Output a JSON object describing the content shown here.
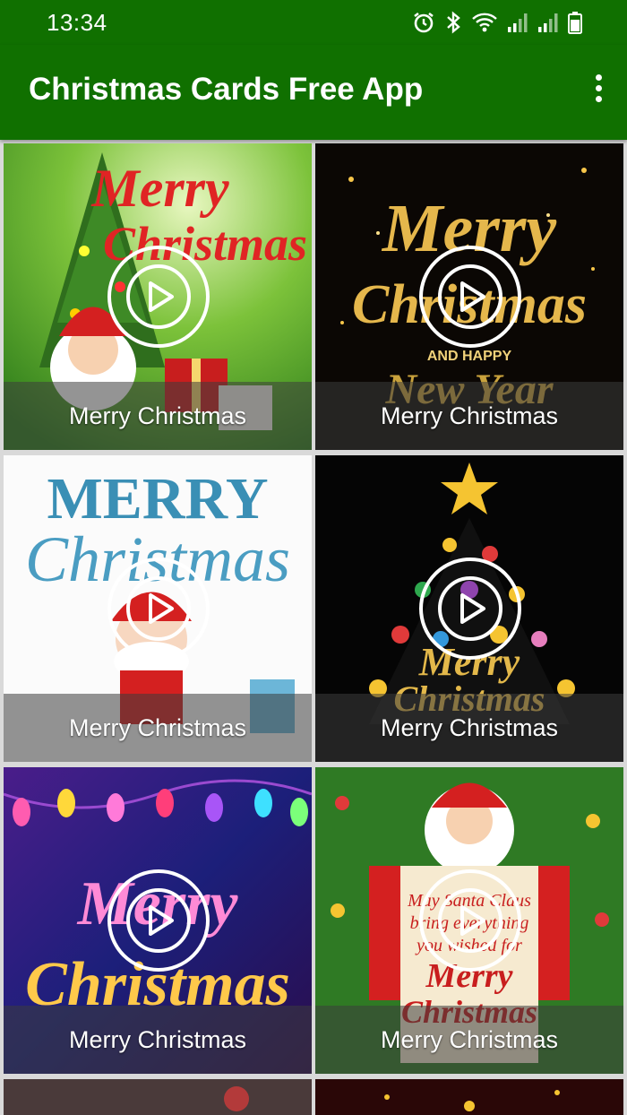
{
  "status_bar": {
    "time": "13:34",
    "icons": [
      "alarm-icon",
      "bluetooth-icon",
      "wifi-icon",
      "signal-icon",
      "signal-icon",
      "battery-icon"
    ]
  },
  "app_bar": {
    "title": "Christmas Cards Free App",
    "menu_icon": "more-vert-icon",
    "color": "#107000"
  },
  "cards": [
    {
      "label": "Merry Christmas"
    },
    {
      "label": "Merry Christmas"
    },
    {
      "label": "Merry Christmas"
    },
    {
      "label": "Merry Christmas"
    },
    {
      "label": "Merry Christmas"
    },
    {
      "label": "Merry Christmas"
    }
  ]
}
